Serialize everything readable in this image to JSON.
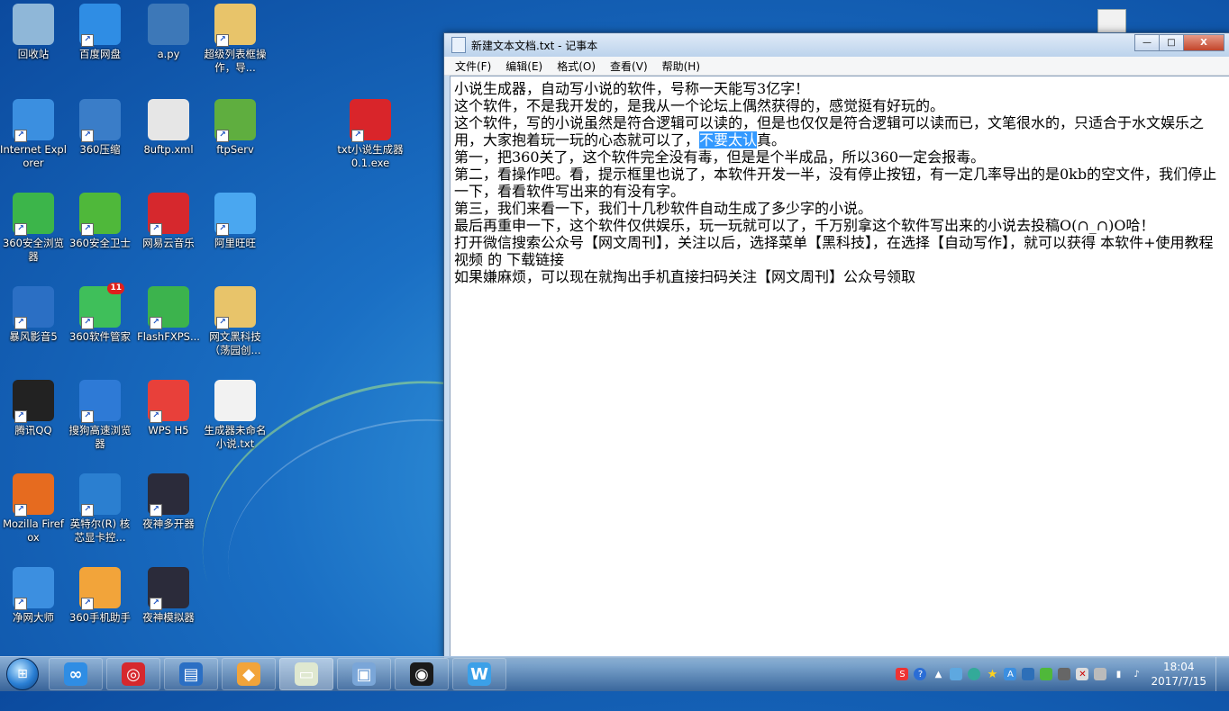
{
  "desktop": {
    "icons": [
      {
        "label": "回收站",
        "icon": "recycle-bin-icon",
        "color": "#8fb7d8"
      },
      {
        "label": "百度网盘",
        "icon": "baidu-netdisk-icon",
        "color": "#2f8de4"
      },
      {
        "label": "a.py",
        "icon": "python-file-icon",
        "color": "#3d78b8"
      },
      {
        "label": "超级列表框操作，导...",
        "icon": "folder-icon",
        "color": "#e8c46a"
      },
      {
        "label": "Internet Explorer",
        "icon": "internet-explorer-icon",
        "color": "#3b8fe0"
      },
      {
        "label": "360压缩",
        "icon": "360-zip-icon",
        "color": "#3a7dc8"
      },
      {
        "label": "8uftp.xml",
        "icon": "xml-file-icon",
        "color": "#e6e6e6"
      },
      {
        "label": "ftpServ",
        "icon": "ftp-server-icon",
        "color": "#5fae3f"
      },
      {
        "label": "txt小说生成器0.1.exe",
        "icon": "fly-app-icon",
        "color": "#d9252a"
      },
      {
        "label": "360安全浏览器",
        "icon": "360-browser-icon",
        "color": "#3cb54a"
      },
      {
        "label": "360安全卫士",
        "icon": "360-security-icon",
        "color": "#4fb83a"
      },
      {
        "label": "网易云音乐",
        "icon": "netease-music-icon",
        "color": "#d6282d"
      },
      {
        "label": "阿里旺旺",
        "icon": "aliwangwang-icon",
        "color": "#4aa7f0"
      },
      {
        "label": "暴风影音5",
        "icon": "baofeng-icon",
        "color": "#2b6fc4"
      },
      {
        "label": "360软件管家",
        "icon": "360-software-icon",
        "color": "#3fbf5a",
        "badge": "11"
      },
      {
        "label": "FlashFXPS...",
        "icon": "flashfxp-icon",
        "color": "#3cb34d"
      },
      {
        "label": "网文黑科技（荡园创...",
        "icon": "folder-icon",
        "color": "#e8c46a"
      },
      {
        "label": "腾讯QQ",
        "icon": "qq-icon",
        "color": "#222222"
      },
      {
        "label": "搜狗高速浏览器",
        "icon": "sogou-browser-icon",
        "color": "#2e7ad6"
      },
      {
        "label": "WPS H5",
        "icon": "wps-h5-icon",
        "color": "#e8403a"
      },
      {
        "label": "生成器未命名小说.txt",
        "icon": "text-file-icon",
        "color": "#f2f2f2"
      },
      {
        "label": "Mozilla Firefox",
        "icon": "firefox-icon",
        "color": "#e66b1f"
      },
      {
        "label": "英特尔(R) 核芯显卡控...",
        "icon": "intel-graphics-icon",
        "color": "#2b7fd0"
      },
      {
        "label": "夜神多开器",
        "icon": "nox-multi-icon",
        "color": "#2b2b3a"
      },
      {
        "label": "净网大师",
        "icon": "adsafe-icon",
        "color": "#3c8fe0"
      },
      {
        "label": "360手机助手",
        "icon": "360-mobile-icon",
        "color": "#f2a43a"
      },
      {
        "label": "夜神模拟器",
        "icon": "nox-emulator-icon",
        "color": "#2b2b3a"
      }
    ]
  },
  "notepad": {
    "title": "新建文本文档.txt - 记事本",
    "menu": [
      "文件(F)",
      "编辑(E)",
      "格式(O)",
      "查看(V)",
      "帮助(H)"
    ],
    "controls": {
      "minimize": "—",
      "maximize": "□",
      "close": "X"
    },
    "lines": [
      "小说生成器，自动写小说的软件，号称一天能写3亿字！",
      "这个软件，不是我开发的，是我从一个论坛上偶然获得的，感觉挺有好玩的。",
      "这个软件，写的小说虽然是符合逻辑可以读的，但是也仅仅是符合逻辑可以读而已，文笔很水的，只适合于水文娱乐之用，大家抱着玩一玩的心态就可以了，",
      "第一，把360关了，这个软件完全没有毒，但是是个半成品，所以360一定会报毒。",
      "第二，看操作吧。看，提示框里也说了，本软件开发一半，没有停止按钮，有一定几率导出的是0kb的空文件，我们停止一下，看看软件写出来的有没有字。",
      "第三，我们来看一下，我们十几秒软件自动生成了多少字的小说。",
      "最后再重申一下，这个软件仅供娱乐，玩一玩就可以了，千万别拿这个软件写出来的小说去投稿O(∩_∩)O哈！",
      "打开微信搜索公众号【网文周刊】，关注以后，选择菜单【黑科技】，在选择【自动写作】，就可以获得 本软件+使用教程视频 的 下载链接",
      "如果嫌麻烦，可以现在就掏出手机直接扫码关注【网文周刊】公众号领取"
    ],
    "selected_text": "不要太认",
    "after_selected": "真。"
  },
  "taskbar": {
    "start_icon": "windows-start-icon",
    "buttons": [
      {
        "name": "baidu-netdisk-task",
        "glyph": "∞",
        "color": "#2f8de4"
      },
      {
        "name": "netease-music-task",
        "glyph": "◎",
        "color": "#d6282d"
      },
      {
        "name": "baofeng-task",
        "glyph": "▤",
        "color": "#2b6fc4"
      },
      {
        "name": "360-mobile-task",
        "glyph": "◆",
        "color": "#f2a43a"
      },
      {
        "name": "notepad-task",
        "glyph": "▭",
        "color": "#dfe8d0"
      },
      {
        "name": "image-viewer-task",
        "glyph": "▣",
        "color": "#7aa6d8"
      },
      {
        "name": "obs-task",
        "glyph": "◉",
        "color": "#1a1a1a"
      },
      {
        "name": "wps-task",
        "glyph": "W",
        "color": "#3ba0e8"
      }
    ],
    "clock": {
      "time": "18:04",
      "date": "2017/7/15"
    }
  }
}
